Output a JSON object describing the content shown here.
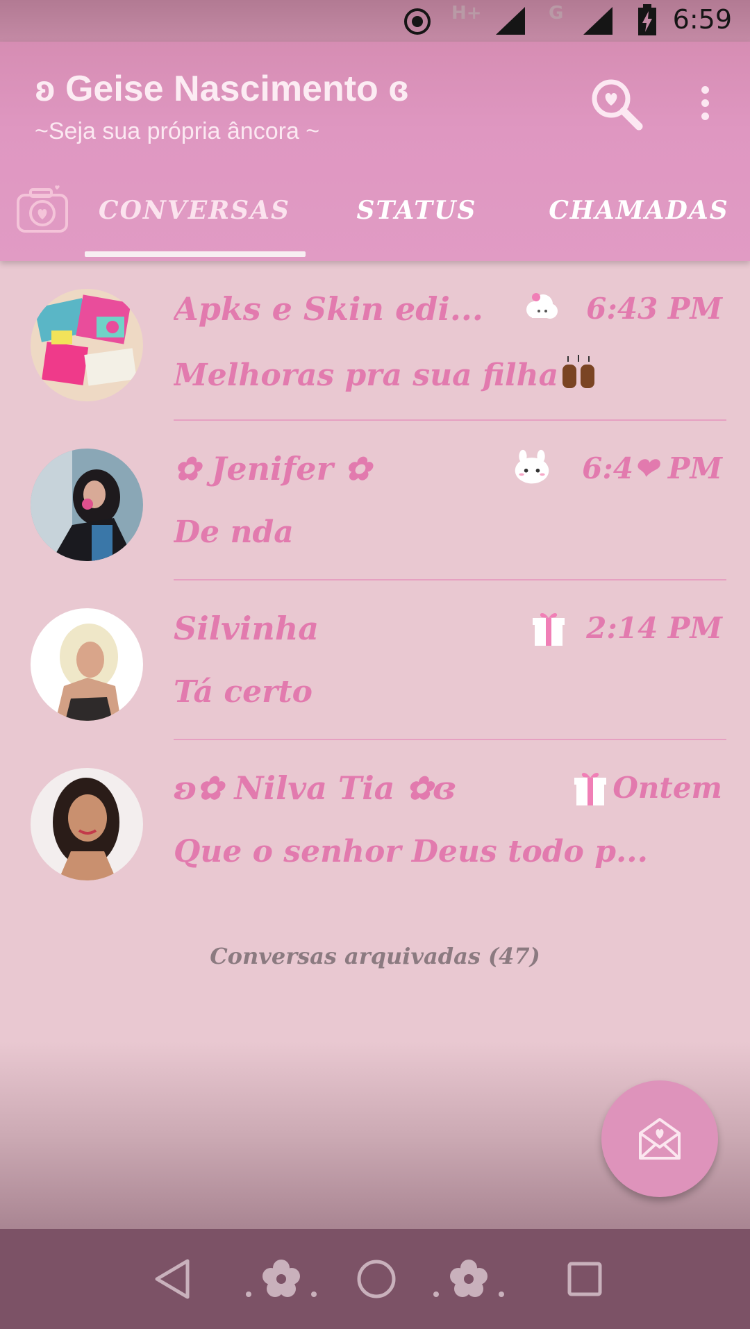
{
  "status_bar": {
    "network_1": "H+",
    "network_2": "G",
    "time": "6:59"
  },
  "header": {
    "title": "ʚ Geise Nascimento ɞ",
    "subtitle": "~Seja sua própria âncora ~",
    "icons": [
      "search-icon",
      "more-options-icon"
    ]
  },
  "tabs": [
    {
      "label": "CONVERSAS",
      "active": true
    },
    {
      "label": "STATUS",
      "active": false
    },
    {
      "label": "CHAMADAS",
      "active": false
    }
  ],
  "chats": [
    {
      "name": "Apks e Skin edi...",
      "time": "6:43 PM",
      "message": "Melhoras pra sua filha",
      "time_icon": "cloud-icon",
      "message_emoji": "raised-hands-icon"
    },
    {
      "name": "✿ Jenifer ✿",
      "time": "6:4❤ PM",
      "message": "De nda",
      "time_icon": "bunny-icon"
    },
    {
      "name": "Silvinha",
      "time": "2:14 PM",
      "message": "Tá certo",
      "time_icon": "gift-icon"
    },
    {
      "name": "ʚ✿ Nilva Tia ✿ɞ",
      "time": "Ontem",
      "message": "Que o senhor Deus todo p...",
      "time_icon": "gift-icon"
    }
  ],
  "archived": "Conversas arquivadas (47)",
  "colors": {
    "accent": "#e27aae",
    "header": "#e19bc4",
    "background": "#e9c8d1",
    "navbar": "#7c5266"
  }
}
